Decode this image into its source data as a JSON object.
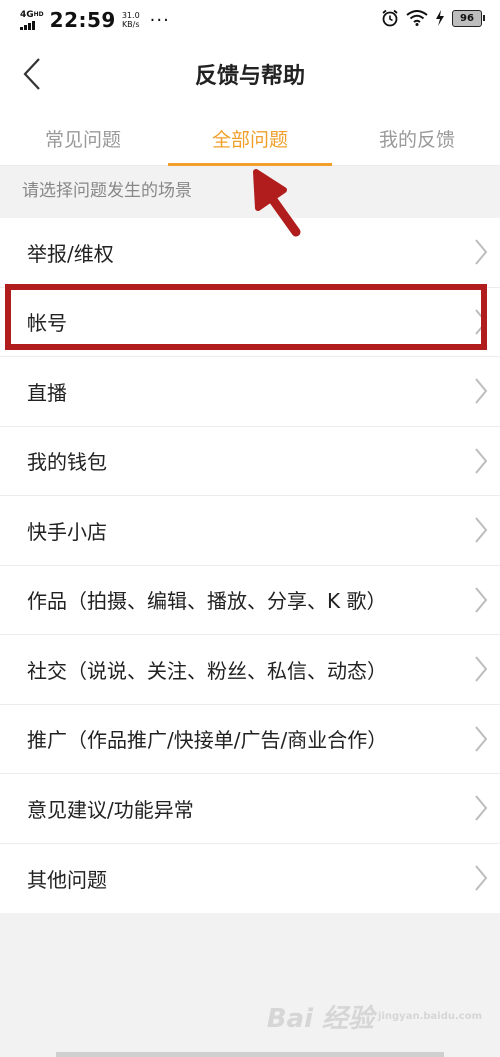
{
  "status_bar": {
    "network": "4G",
    "network_sup": "HD",
    "time": "22:59",
    "speed_value": "31.0",
    "speed_unit": "KB/s",
    "more": "···",
    "battery": "96"
  },
  "header": {
    "title": "反馈与帮助"
  },
  "tabs": [
    {
      "label": "常见问题"
    },
    {
      "label": "全部问题"
    },
    {
      "label": "我的反馈"
    }
  ],
  "active_tab_index": 1,
  "section_header": "请选择问题发生的场景",
  "list_items": [
    {
      "label": "举报/维权"
    },
    {
      "label": "帐号"
    },
    {
      "label": "直播"
    },
    {
      "label": "我的钱包"
    },
    {
      "label": "快手小店"
    },
    {
      "label": "作品（拍摄、编辑、播放、分享、K 歌）"
    },
    {
      "label": "社交（说说、关注、粉丝、私信、动态）"
    },
    {
      "label": "推广（作品推广/快接单/广告/商业合作）"
    },
    {
      "label": "意见建议/功能异常"
    },
    {
      "label": "其他问题"
    }
  ],
  "watermark": {
    "text": "Bai 经验",
    "sub": "jingyan.baidu.com"
  },
  "colors": {
    "accent": "#f0a02b",
    "annotation": "#b11c1c",
    "background": "#f2f2f2"
  },
  "icons": {
    "back": "chevron-left-icon",
    "row": "chevron-right-icon",
    "annotation": "arrow-up-left-icon"
  }
}
